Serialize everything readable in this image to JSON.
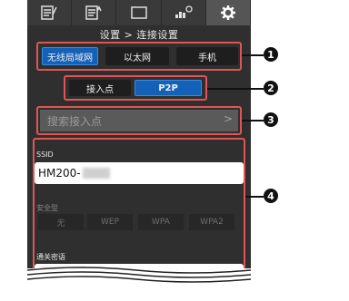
{
  "tabs": [
    {
      "icon": "list-edit-icon"
    },
    {
      "icon": "list-upload-icon"
    },
    {
      "icon": "monitor-icon"
    },
    {
      "icon": "camera-settings-icon"
    },
    {
      "icon": "gear-icon",
      "active": true
    }
  ],
  "header": {
    "title": "设置 > 连接设置"
  },
  "connection_type": {
    "options": [
      "无线局域网",
      "以太网",
      "手机"
    ],
    "selected": "无线局域网"
  },
  "mode": {
    "options": [
      "接入点",
      "P2P"
    ],
    "selected": "P2P"
  },
  "search": {
    "label": "搜索接入点",
    "chevron": ">"
  },
  "ssid": {
    "label": "SSID",
    "value": "HM200-"
  },
  "security": {
    "label": "安全型",
    "options": [
      "无",
      "WEP",
      "WPA",
      "WPA2"
    ]
  },
  "passphrase": {
    "label": "通关密语"
  },
  "callouts": [
    "1",
    "2",
    "3",
    "4"
  ],
  "colors": {
    "accent": "#1461b8",
    "highlight": "#e05555",
    "background": "#2f2f2f"
  }
}
